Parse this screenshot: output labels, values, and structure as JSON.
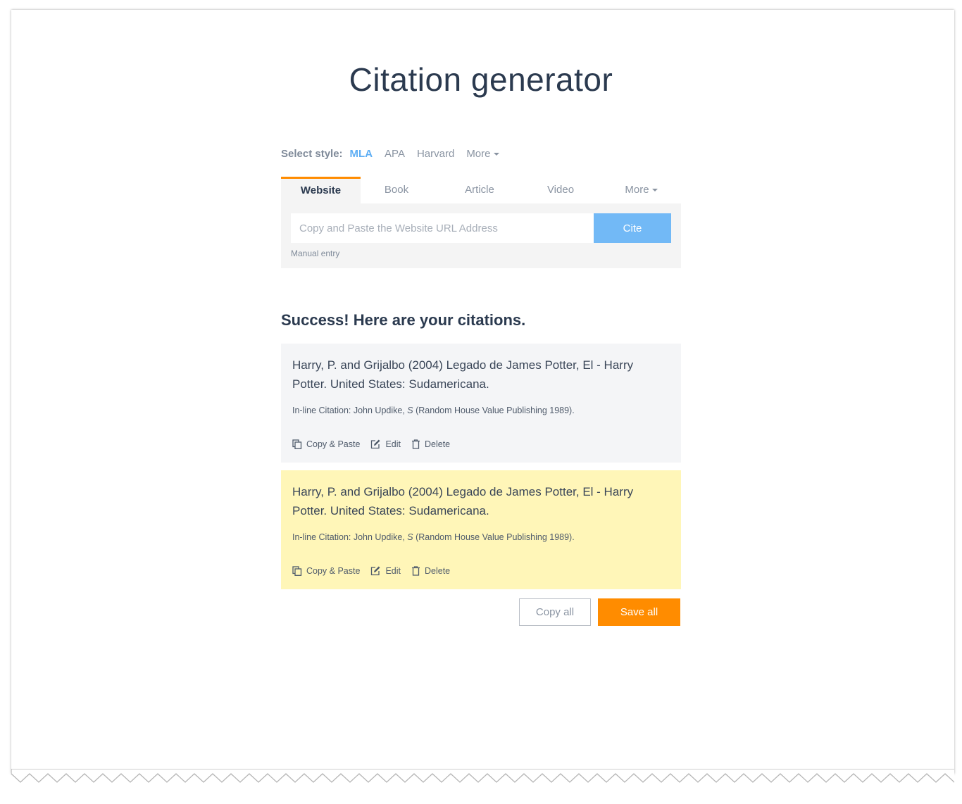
{
  "page": {
    "title": "Citation generator"
  },
  "style_selector": {
    "label": "Select style:",
    "options": [
      "MLA",
      "APA",
      "Harvard",
      "More"
    ],
    "selected": "MLA"
  },
  "source_tabs": {
    "items": [
      "Website",
      "Book",
      "Article",
      "Video",
      "More"
    ],
    "selected": "Website"
  },
  "search": {
    "placeholder": "Copy and Paste the Website URL Address",
    "value": "",
    "cite_label": "Cite",
    "manual_entry_label": "Manual entry"
  },
  "results": {
    "heading": "Success! Here are your citations.",
    "citations": [
      {
        "reference": "Harry, P. and Grijalbo (2004) Legado de James Potter, El - Harry Potter. United States: Sudamericana.",
        "inline_prefix": "In-line Citation: John Updike, ",
        "inline_italic": "S",
        "inline_suffix": " (Random House Value Publishing 1989).",
        "highlighted": false
      },
      {
        "reference": "Harry, P. and Grijalbo (2004) Legado de James Potter, El - Harry Potter. United States: Sudamericana.",
        "inline_prefix": "In-line Citation: John Updike, ",
        "inline_italic": "S",
        "inline_suffix": " (Random House Value Publishing 1989).",
        "highlighted": true
      }
    ],
    "actions": {
      "copy": "Copy & Paste",
      "edit": "Edit",
      "delete": "Delete"
    },
    "copy_all_label": "Copy all",
    "save_all_label": "Save all"
  },
  "colors": {
    "accent_orange": "#ff8c00",
    "accent_blue": "#5eaef4",
    "highlight_yellow": "#fff6b8"
  }
}
